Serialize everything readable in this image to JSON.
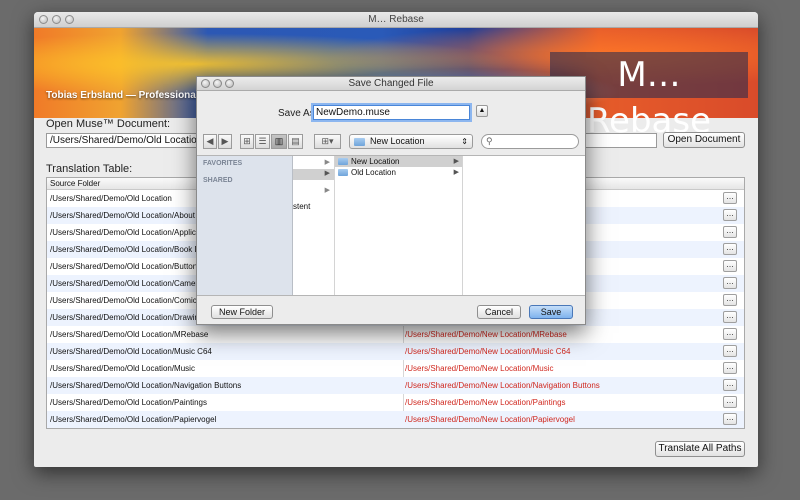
{
  "window": {
    "title": "M… Rebase"
  },
  "banner": {
    "owner": "Tobias Erbsland — Professional Softw",
    "logo_text": "M… Rebase"
  },
  "document": {
    "label": "Open Muse™ Document:",
    "path": "/Users/Shared/Demo/Old Location/D",
    "open_button": "Open Document"
  },
  "translation": {
    "label": "Translation Table:",
    "header_source": "Source Folder",
    "more_label": "…",
    "rows": [
      {
        "src": "/Users/Shared/Demo/Old Location",
        "dst": ""
      },
      {
        "src": "/Users/Shared/Demo/Old Location/About W",
        "dst": ""
      },
      {
        "src": "/Users/Shared/Demo/Old Location/Applicat",
        "dst": ""
      },
      {
        "src": "/Users/Shared/Demo/Old Location/Book DN",
        "dst": ""
      },
      {
        "src": "/Users/Shared/Demo/Old Location/Buttons",
        "dst": ""
      },
      {
        "src": "/Users/Shared/Demo/Old Location/Camera",
        "dst": ""
      },
      {
        "src": "/Users/Shared/Demo/Old Location/Comics",
        "dst": ""
      },
      {
        "src": "/Users/Shared/Demo/Old Location/Drawing",
        "dst": ""
      },
      {
        "src": "/Users/Shared/Demo/Old Location/MRebase",
        "dst": "/Users/Shared/Demo/New Location/MRebase"
      },
      {
        "src": "/Users/Shared/Demo/Old Location/Music C64",
        "dst": "/Users/Shared/Demo/New Location/Music C64"
      },
      {
        "src": "/Users/Shared/Demo/Old Location/Music",
        "dst": "/Users/Shared/Demo/New Location/Music"
      },
      {
        "src": "/Users/Shared/Demo/Old Location/Navigation Buttons",
        "dst": "/Users/Shared/Demo/New Location/Navigation Buttons"
      },
      {
        "src": "/Users/Shared/Demo/Old Location/Paintings",
        "dst": "/Users/Shared/Demo/New Location/Paintings"
      },
      {
        "src": "/Users/Shared/Demo/Old Location/Papiervogel",
        "dst": "/Users/Shared/Demo/New Location/Papiervogel"
      }
    ],
    "translate_button": "Translate All Paths"
  },
  "dialog": {
    "title": "Save Changed File",
    "save_as_label": "Save As:",
    "filename": "NewDemo.muse",
    "disclosure": "▲",
    "back": "◀",
    "forward": "▶",
    "location": "New Location",
    "sidebar": {
      "favorites": "FAVORITES",
      "shared": "SHARED"
    },
    "first_column_partial": "stent",
    "folders": [
      {
        "name": "New Location",
        "selected": true
      },
      {
        "name": "Old Location",
        "selected": false
      }
    ],
    "new_folder_button": "New Folder",
    "cancel_button": "Cancel",
    "save_button": "Save"
  }
}
